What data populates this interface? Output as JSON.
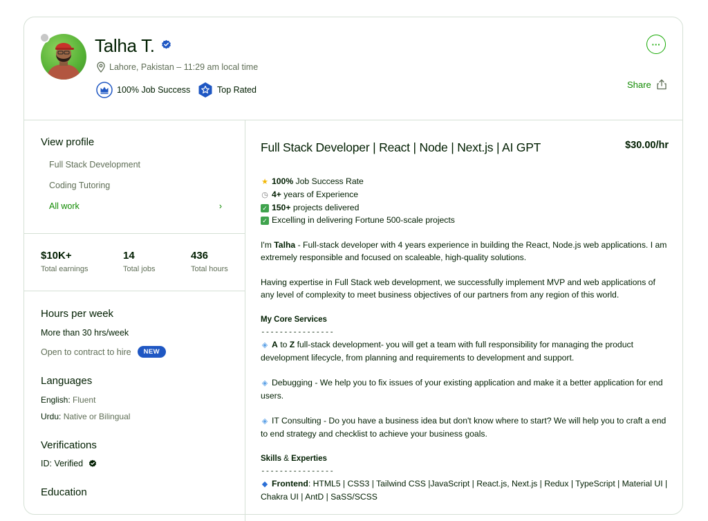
{
  "profile": {
    "name": "Talha T.",
    "location": "Lahore, Pakistan – 11:29 am local time",
    "job_success": "100% Job Success",
    "top_rated": "Top Rated",
    "share_label": "Share",
    "more_label": "···"
  },
  "sidebar": {
    "view_profile_title": "View profile",
    "items": [
      {
        "label": "Full Stack Development"
      },
      {
        "label": "Coding Tutoring"
      },
      {
        "label": "All work",
        "chevron": "›"
      }
    ],
    "stats": [
      {
        "value": "$10K+",
        "label": "Total earnings"
      },
      {
        "value": "14",
        "label": "Total jobs"
      },
      {
        "value": "436",
        "label": "Total hours"
      }
    ],
    "hours_title": "Hours per week",
    "hours_value": "More than 30 hrs/week",
    "open_contract": "Open to contract to hire",
    "new_badge": "NEW",
    "languages_title": "Languages",
    "languages": [
      {
        "name": "English:",
        "level": "Fluent"
      },
      {
        "name": "Urdu:",
        "level": "Native or Bilingual"
      }
    ],
    "verifications_title": "Verifications",
    "verification_value": "ID: Verified",
    "education_title": "Education"
  },
  "main": {
    "title": "Full Stack Developer | React | Node | Next.js | AI GPT",
    "rate": "$30.00/hr",
    "highlights": [
      {
        "icon": "star-emoji",
        "bold": "100%",
        "text": " Job Success Rate"
      },
      {
        "icon": "clock-emoji",
        "bold": "4+",
        "text": " years of Experience"
      },
      {
        "icon": "check-emoji",
        "bold": "150+",
        "text": " projects delivered"
      },
      {
        "icon": "check-emoji",
        "bold": "",
        "text": "Excelling in delivering Fortune 500-scale projects"
      }
    ],
    "intro_prefix": "I'm ",
    "intro_bold": "Talha",
    "intro_rest": " - Full-stack developer with 4 years experience in building the React, Node.js web applications. I am extremely responsible and focused on scaleable, high-quality solutions.",
    "expertise": "Having expertise in Full Stack web development, we successfully implement MVP and web applications of any level of complexity to meet business objectives of our partners from any region of this world.",
    "core_title": "My Core Services",
    "separator": "----------------",
    "core_1_a": "A",
    "core_1_to": " to ",
    "core_1_z": "Z",
    "core_1_rest": " full-stack development- you will get a team with full responsibility for managing the product development lifecycle, from planning and requirements to development and support.",
    "core_2": "Debugging - We help you to fix issues of your existing application and make it a better application for end users.",
    "core_3": "IT Consulting - Do you have a business idea but don't know where to start? We will help you to craft a end to end strategy and checklist to achieve your business goals.",
    "skills_title_a": "Skills",
    "skills_title_amp": " & ",
    "skills_title_b": "Experties",
    "frontend_label": "Frontend",
    "frontend_text": ": HTML5 | CSS3 | Tailwind CSS |JavaScript | React.js, Next.js | Redux | TypeScript | Material UI | Chakra UI | AntD | SaSS/SCSS"
  },
  "colors": {
    "accent_green": "#108a00",
    "badge_blue": "#1f57c3",
    "text_muted": "#5e6d55",
    "border": "#d5e0d5"
  }
}
